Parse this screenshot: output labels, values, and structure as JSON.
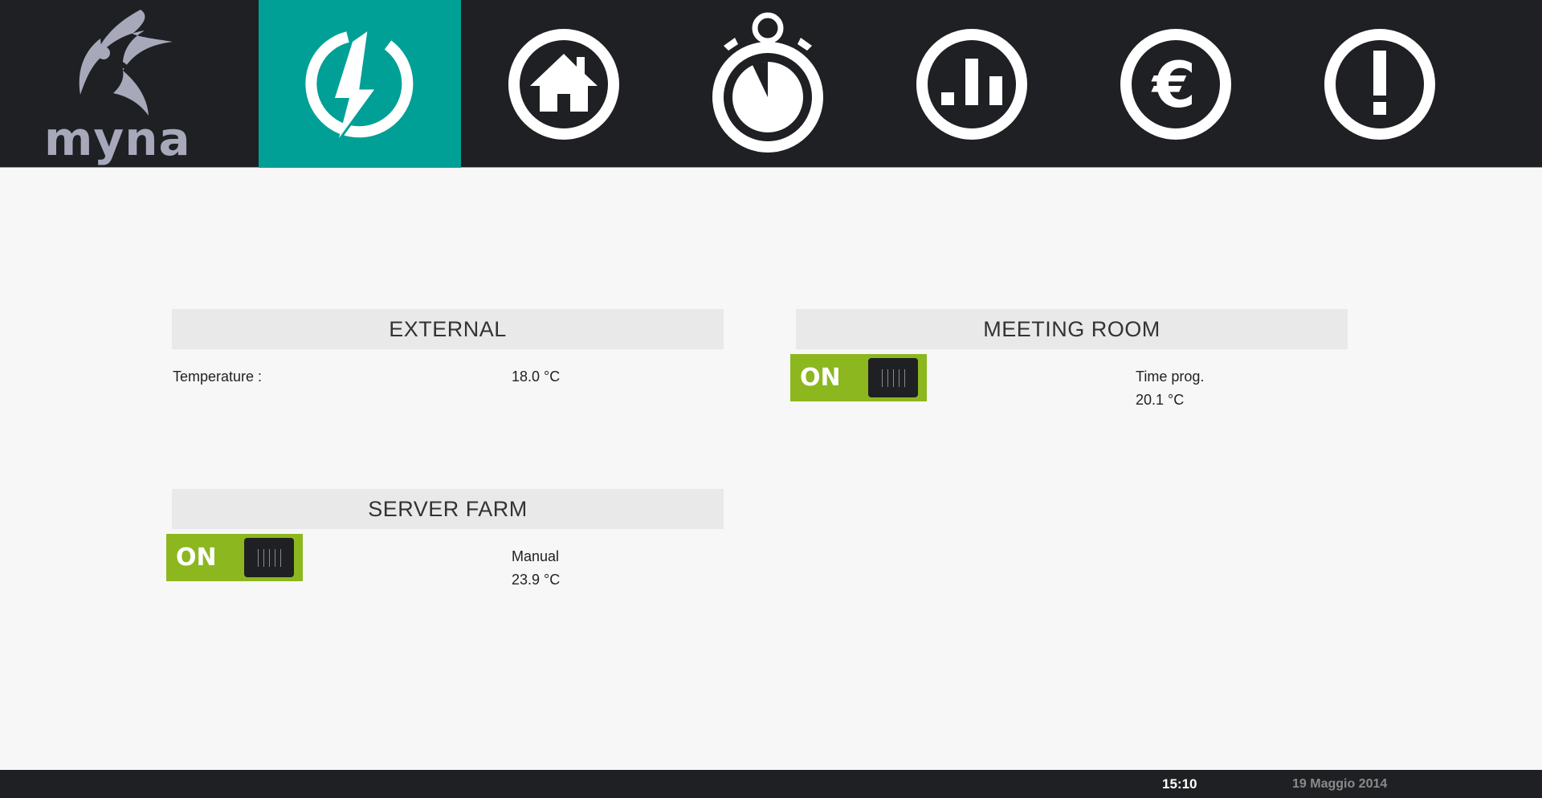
{
  "app": {
    "logo_text": "myna"
  },
  "nav": {
    "items": [
      {
        "icon": "power-bolt-icon",
        "active": true
      },
      {
        "icon": "home-icon",
        "active": false
      },
      {
        "icon": "stopwatch-icon",
        "active": false
      },
      {
        "icon": "bar-chart-icon",
        "active": false
      },
      {
        "icon": "euro-icon",
        "active": false
      },
      {
        "icon": "alert-icon",
        "active": false
      }
    ],
    "active_color": "#00a096"
  },
  "panels": {
    "external": {
      "title": "EXTERNAL",
      "temperature_label": "Temperature :",
      "temperature_value": "18.0 °C"
    },
    "meeting_room": {
      "title": "MEETING ROOM",
      "toggle_label": "ON",
      "mode": "Time prog.",
      "temperature": "20.1 °C"
    },
    "server_farm": {
      "title": "SERVER FARM",
      "toggle_label": "ON",
      "mode": "Manual",
      "temperature": "23.9 °C"
    }
  },
  "footer": {
    "time": "15:10",
    "date": "19 Maggio 2014"
  },
  "colors": {
    "bar_bg": "#1f2023",
    "toggle_on": "#8db71f",
    "panel_header": "#e9e9e9",
    "page_bg": "#f7f7f7"
  }
}
